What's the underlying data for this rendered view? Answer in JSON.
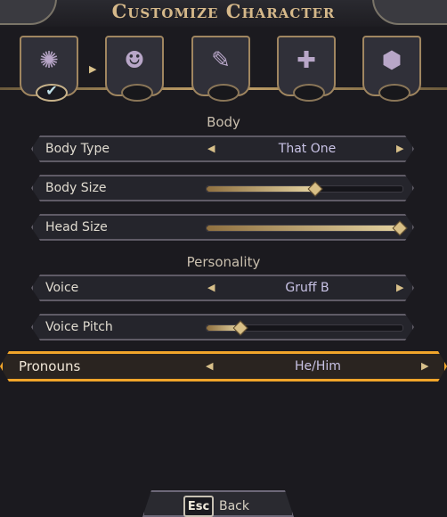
{
  "title": "Customize Character",
  "tabs": [
    {
      "name": "appearance",
      "icon": "flame-crest-icon",
      "selected": true
    },
    {
      "name": "head",
      "icon": "voodoo-doll-icon",
      "selected": false
    },
    {
      "name": "origin",
      "icon": "book-quill-icon",
      "selected": false
    },
    {
      "name": "abilities",
      "icon": "figure-plus-icon",
      "selected": false
    },
    {
      "name": "dice",
      "icon": "d20-icon",
      "selected": false
    }
  ],
  "sections": {
    "body": "Body",
    "personality": "Personality"
  },
  "rows": {
    "body_type": {
      "label": "Body Type",
      "value": "That One"
    },
    "body_size": {
      "label": "Body Size",
      "level": 0.55
    },
    "head_size": {
      "label": "Head Size",
      "level": 0.98
    },
    "voice": {
      "label": "Voice",
      "value": "Gruff B"
    },
    "voice_pitch": {
      "label": "Voice Pitch",
      "level": 0.17
    },
    "pronouns": {
      "label": "Pronouns",
      "value": "He/Him"
    }
  },
  "footer": {
    "key": "Esc",
    "action": "Back"
  },
  "colors": {
    "accent": "#f1a52a",
    "gold": "#d8c08a",
    "panel": "#25252c"
  }
}
